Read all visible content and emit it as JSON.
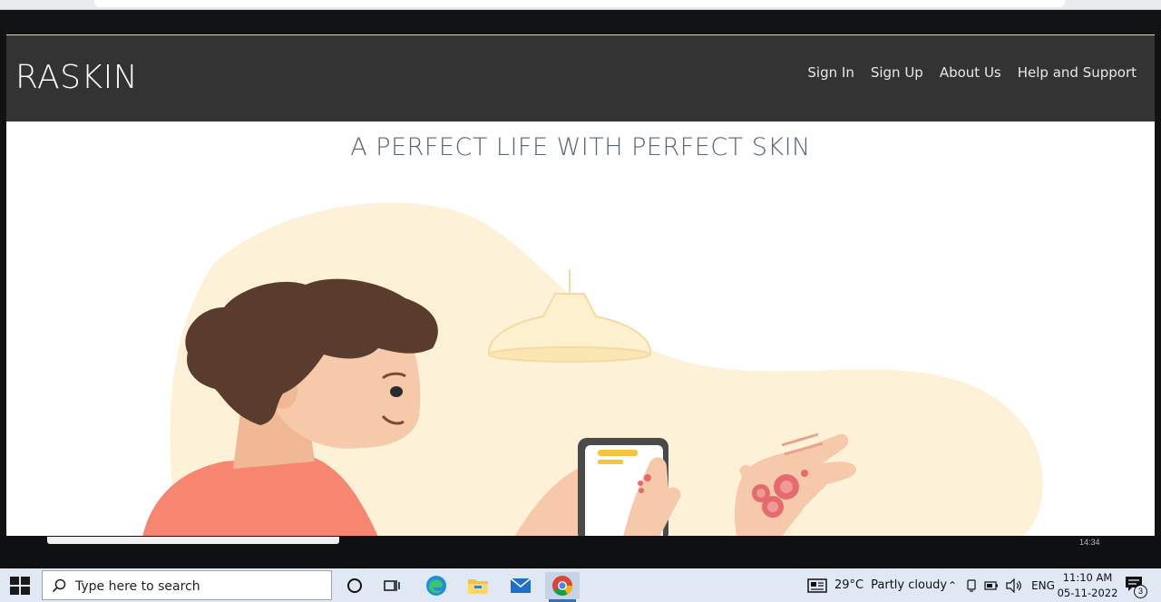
{
  "site": {
    "brand": "RASKIN",
    "nav": [
      "Sign In",
      "Sign Up",
      "About Us",
      "Help and Support"
    ],
    "headline": "A PERFECT LIFE WITH PERFECT SKIN"
  },
  "overlay": {
    "time": "14:34"
  },
  "taskbar": {
    "search_placeholder": "Type here to search",
    "weather": {
      "temp": "29°C",
      "condition": "Partly cloudy"
    },
    "language": "ENG",
    "clock": {
      "time": "11:10 AM",
      "date": "05-11-2022"
    },
    "notifications": "3",
    "pinned": [
      "task-view",
      "edge",
      "file-explorer",
      "mail",
      "chrome"
    ]
  },
  "colors": {
    "navbar": "#333333",
    "headline": "#5a6570",
    "blob": "#fdf1d8",
    "hair": "#5a3c2e",
    "skin": "#f5c9a9",
    "shirt": "#f6866f",
    "rash": "#e56a6e",
    "accent": "#2f6fc5"
  }
}
